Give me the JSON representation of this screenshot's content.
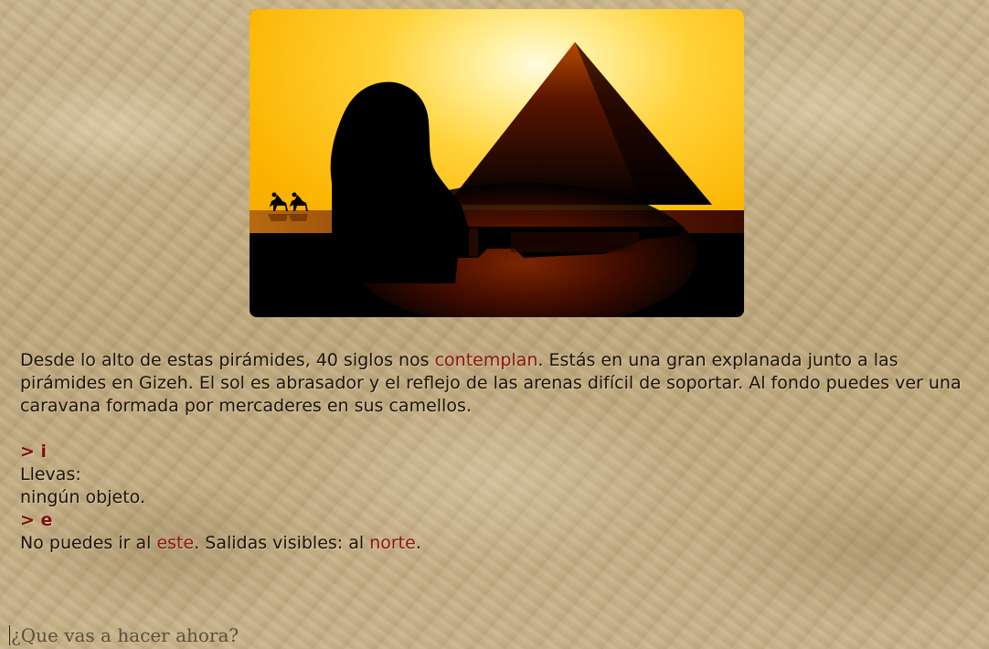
{
  "scene": {
    "icon": "giza-pyramids-sphinx-illustration",
    "sky_colors": [
      "#fff6c8",
      "#ffd24a",
      "#f9a800"
    ]
  },
  "story": {
    "description_part1": "Desde lo alto de estas pirámides, 40 siglos nos ",
    "description_link": "contemplan",
    "description_part2": ". Estás en una gran explanada junto a las pirámides en Gizeh. El sol es abrasador y el reflejo de las arenas difícil de soportar. Al fondo puedes ver una caravana formada por mercaderes en sus camellos.",
    "command_1": "> i",
    "inventory_heading": "Llevas:",
    "inventory_items": "ningún objeto.",
    "command_2": "> e",
    "response_part1": "No puedes ir al ",
    "response_link1": "este",
    "response_part2": ". Salidas visibles: al ",
    "response_link2": "norte",
    "response_part3": "."
  },
  "input": {
    "value": "",
    "placeholder": "¿Que vas a hacer ahora?"
  },
  "colors": {
    "link": "#8c1414",
    "command": "#7a1010",
    "parchment": "#c4ae84"
  }
}
